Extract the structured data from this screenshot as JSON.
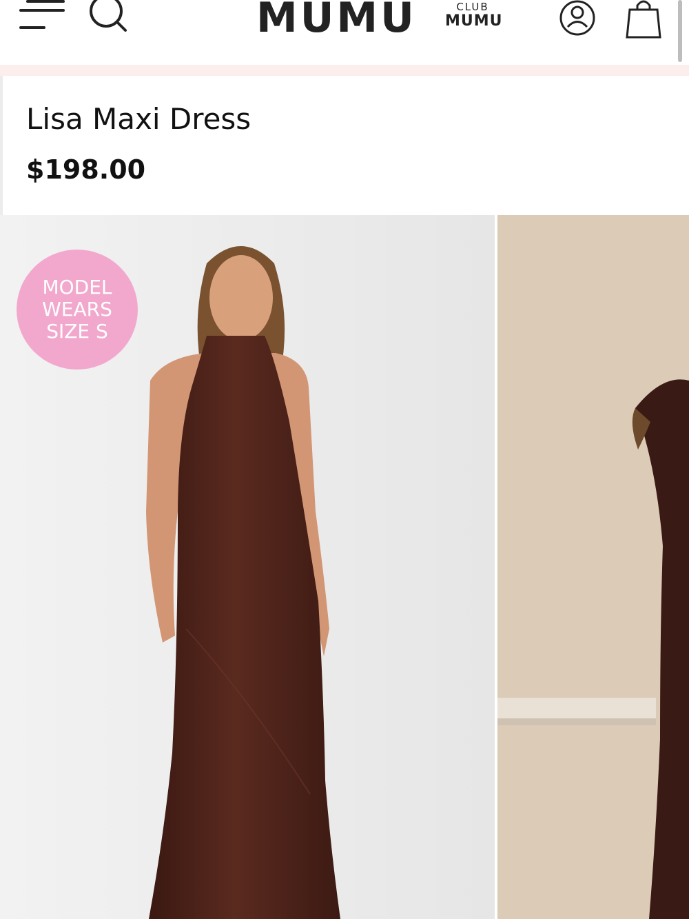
{
  "header": {
    "logo": "MUMU",
    "club_small": "CLUB",
    "club_big": "MUMU",
    "icons": [
      "menu-icon",
      "search-icon",
      "account-icon",
      "shopping-bag-icon"
    ]
  },
  "product": {
    "title": "Lisa Maxi Dress",
    "price": "$198.00"
  },
  "gallery": {
    "badge": [
      "MODEL",
      "WEARS",
      "SIZE S"
    ]
  },
  "colors": {
    "badge": "#f2a8cd",
    "strip": "#fdeeee",
    "dress": "#4a2118",
    "wall": "#dccbb6"
  }
}
